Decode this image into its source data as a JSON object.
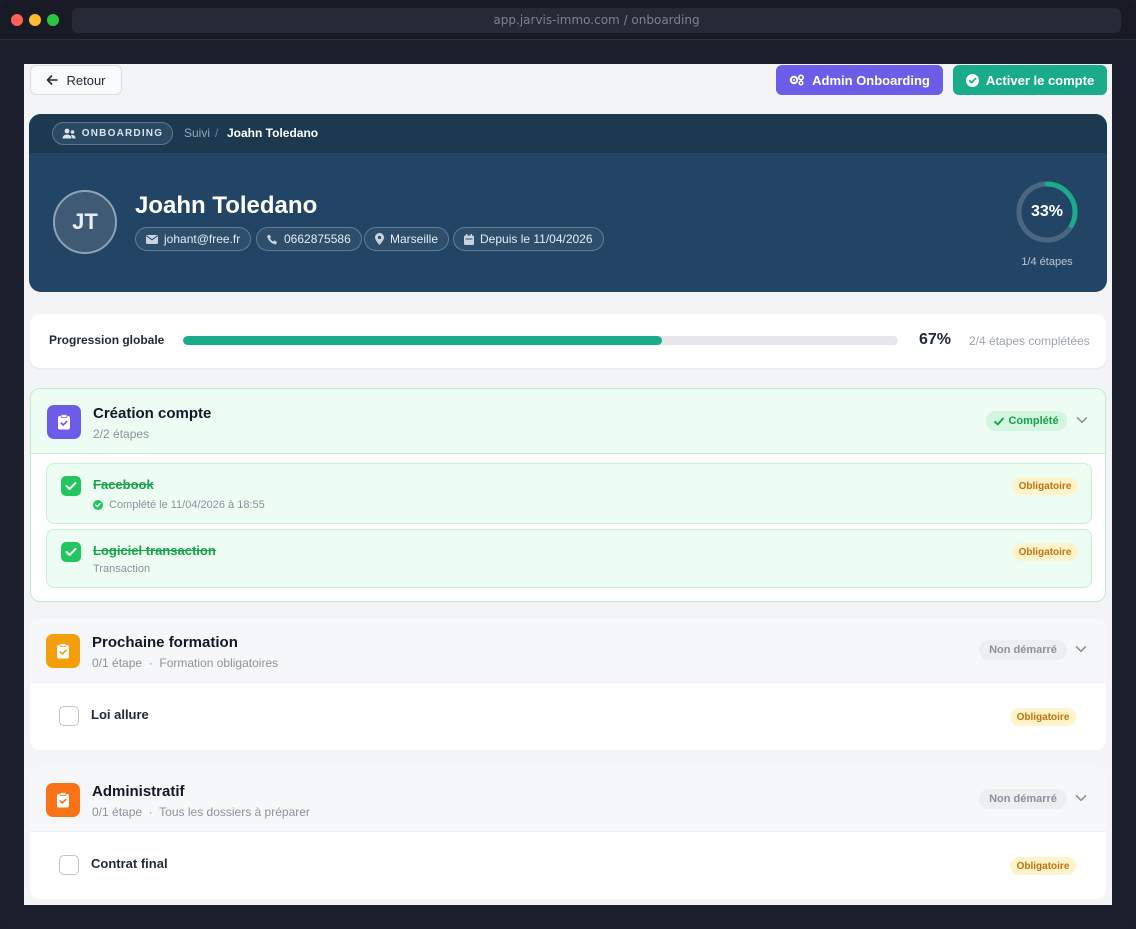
{
  "browser": {
    "url": "app.jarvis-immo.com / onboarding"
  },
  "toolbar": {
    "back_label": "Retour",
    "admin_label": "Admin Onboarding",
    "activate_label": "Activer le compte"
  },
  "hero": {
    "badge": "ONBOARDING",
    "breadcrumb": {
      "parent": "Suivi",
      "separator": "/",
      "current": "Joahn Toledano"
    },
    "initials": "JT",
    "name": "Joahn Toledano",
    "email": "johant@free.fr",
    "phone": "0662875586",
    "city": "Marseille",
    "since": "Depuis le 11/04/2026",
    "ring_percent_label": "33%",
    "ring_percent": 33,
    "steps_label": "1/4 étapes"
  },
  "progress": {
    "label": "Progression globale",
    "percent": 67,
    "percent_label": "67%",
    "summary": "2/4 étapes complétées"
  },
  "sections": [
    {
      "title": "Création compte",
      "subtitle": "2/2 étapes",
      "status": "Complété",
      "tasks": [
        {
          "title": "Facebook",
          "subtitle": "Complété le 11/04/2026 à 18:55",
          "badge": "Obligatoire",
          "done": true
        },
        {
          "title": "Logiciel transaction",
          "subtitle": "Transaction",
          "badge": "Obligatoire",
          "done": true
        }
      ]
    },
    {
      "title": "Prochaine formation",
      "subtitle": "0/1 étape",
      "subtitle_extra": "Formation obligatoires",
      "status": "Non démarré",
      "tasks": [
        {
          "title": "Loi allure",
          "badge": "Obligatoire",
          "done": false
        }
      ]
    },
    {
      "title": "Administratif",
      "subtitle": "0/1 étape",
      "subtitle_extra": "Tous les dossiers à préparer",
      "status": "Non démarré",
      "tasks": [
        {
          "title": "Contrat final",
          "badge": "Obligatoire",
          "done": false
        }
      ]
    }
  ],
  "colors": {
    "hero_bg": "#224565",
    "accent_teal": "#1aab8a",
    "accent_purple": "#6c5ce7",
    "done_green": "#22c55e",
    "section_icon_1": "#6c5ce7",
    "section_icon_2": "#f59e0b",
    "section_icon_3": "#f97316"
  }
}
